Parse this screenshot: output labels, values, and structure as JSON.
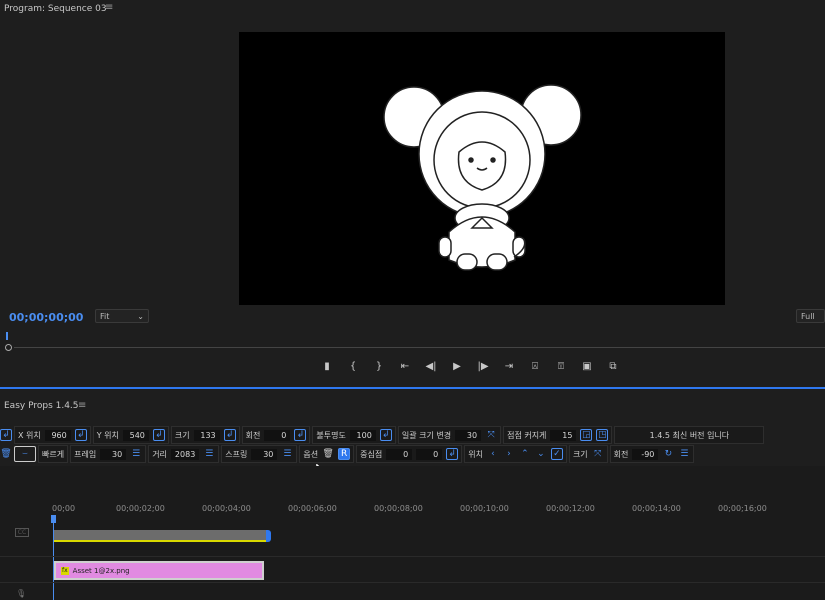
{
  "program_monitor": {
    "title": "Program: Sequence 03",
    "timecode": "00;00;00;00",
    "fit_option": "Fit",
    "quality": "Full"
  },
  "transport": {
    "marker": "▮",
    "mark_in": "{",
    "mark_out": "}",
    "go_to_in": "⇤",
    "step_back": "◀|",
    "play": "▶",
    "step_forward": "|▶",
    "go_to_out": "⇥",
    "lift": "⍓",
    "extract": "⍔",
    "export_frame": "▣",
    "compare": "⧉"
  },
  "easy_props": {
    "title": "Easy Props 1.4.5",
    "row1": {
      "x_label": "X 위치",
      "x_value": "960",
      "y_label": "Y 위치",
      "y_value": "540",
      "scale_label": "크기",
      "scale_value": "133",
      "rotation_label": "회전",
      "rotation_value": "0",
      "opacity_label": "불투명도",
      "opacity_value": "100",
      "uniform_scale_label": "일괄 크기 변경",
      "uniform_scale_value": "30",
      "grow_label": "점점 커지게",
      "grow_value": "15",
      "version_text": "1.4.5 최신 버전 입니다"
    },
    "row2": {
      "speed_label": "빠르게",
      "frame_label": "프레임",
      "frame_value": "30",
      "distance_label": "거리",
      "distance_value": "2083",
      "spring_label": "스프링",
      "spring_value": "30",
      "options_label": "옵션",
      "r_button": "R",
      "anchor_label": "중심점",
      "anchor_x": "0",
      "anchor_y": "0",
      "position_label": "위치",
      "size_label": "크기",
      "rotate_label": "회전",
      "rotate_value": "-90"
    }
  },
  "timeline": {
    "ruler": [
      "00;00",
      "00;00;02;00",
      "00;00;04;00",
      "00;00;06;00",
      "00;00;08;00",
      "00;00;10;00",
      "00;00;12;00",
      "00;00;14;00",
      "00;00;16;00"
    ],
    "clip_name": "Asset 1@2x.png",
    "fx_badge": "fx",
    "caption_track": "CC"
  }
}
